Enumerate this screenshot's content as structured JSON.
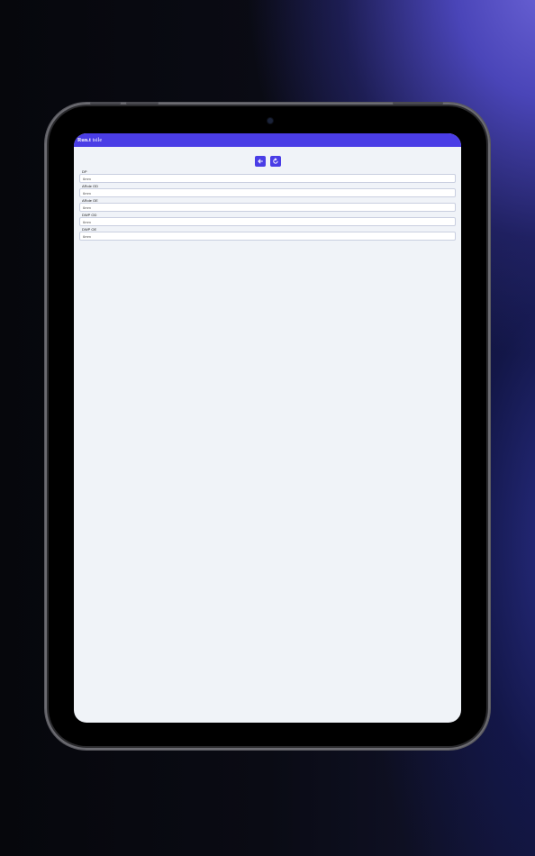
{
  "app": {
    "title_bold": "Run.t",
    "title_rest": "tsile"
  },
  "toolbar": {
    "back_icon": "arrow-left-icon",
    "refresh_icon": "refresh-icon"
  },
  "fields": [
    {
      "label": "DP",
      "value": "6mm"
    },
    {
      "label": "ARole OD",
      "value": "6mm"
    },
    {
      "label": "ARole OE",
      "value": "6mm"
    },
    {
      "label": "DWP OD",
      "value": "6mm"
    },
    {
      "label": "DWP OE",
      "value": "6mm"
    }
  ],
  "colors": {
    "accent": "#4a3de6",
    "screen_bg": "#f0f3f8"
  }
}
